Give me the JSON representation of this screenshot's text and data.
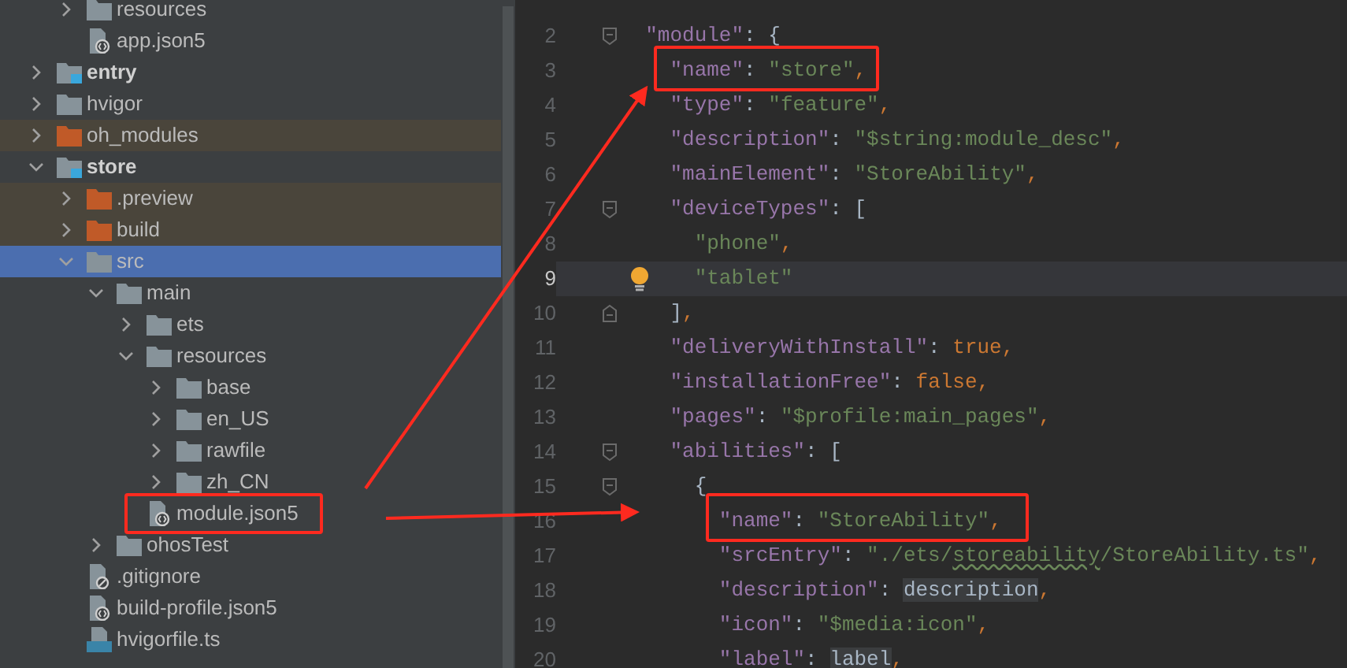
{
  "project_tree": [
    {
      "children": [
        {
          "label": "resources",
          "kind": "folder",
          "expanded": false,
          "excluded": false,
          "selected": false,
          "boxed": false
        },
        {
          "label": "app.json5",
          "kind": "json5",
          "selected": false,
          "boxed": false
        }
      ]
    },
    {
      "label": "entry",
      "kind": "module",
      "expanded": false,
      "excluded": false,
      "selected": false,
      "boxed": false
    },
    {
      "label": "hvigor",
      "kind": "folder",
      "expanded": false,
      "excluded": false,
      "selected": false,
      "boxed": false
    },
    {
      "label": "oh_modules",
      "kind": "folder",
      "expanded": false,
      "excluded": true,
      "selected": false,
      "boxed": false
    },
    {
      "label": "store",
      "kind": "module",
      "expanded": true,
      "excluded": false,
      "selected": false,
      "boxed": false,
      "children": [
        {
          "label": ".preview",
          "kind": "folder",
          "expanded": false,
          "excluded": true,
          "selected": false,
          "boxed": false
        },
        {
          "label": "build",
          "kind": "folder",
          "expanded": false,
          "excluded": true,
          "selected": false,
          "boxed": false
        },
        {
          "label": "src",
          "kind": "folder",
          "expanded": true,
          "excluded": false,
          "selected": true,
          "boxed": false,
          "children": [
            {
              "label": "main",
              "kind": "folder",
              "expanded": true,
              "excluded": false,
              "selected": false,
              "boxed": false,
              "children": [
                {
                  "label": "ets",
                  "kind": "folder",
                  "expanded": false,
                  "excluded": false,
                  "selected": false,
                  "boxed": false
                },
                {
                  "label": "resources",
                  "kind": "folder",
                  "expanded": true,
                  "excluded": false,
                  "selected": false,
                  "boxed": false,
                  "children": [
                    {
                      "label": "base",
                      "kind": "folder",
                      "expanded": false,
                      "excluded": false,
                      "selected": false,
                      "boxed": false
                    },
                    {
                      "label": "en_US",
                      "kind": "folder",
                      "expanded": false,
                      "excluded": false,
                      "selected": false,
                      "boxed": false
                    },
                    {
                      "label": "rawfile",
                      "kind": "folder",
                      "expanded": false,
                      "excluded": false,
                      "selected": false,
                      "boxed": false
                    },
                    {
                      "label": "zh_CN",
                      "kind": "folder",
                      "expanded": false,
                      "excluded": false,
                      "selected": false,
                      "boxed": false
                    }
                  ]
                },
                {
                  "label": "module.json5",
                  "kind": "json5",
                  "selected": false,
                  "boxed": true
                }
              ]
            },
            {
              "label": "ohosTest",
              "kind": "folder",
              "expanded": false,
              "excluded": false,
              "selected": false,
              "boxed": false
            }
          ]
        },
        {
          "label": ".gitignore",
          "kind": "gitignore",
          "selected": false,
          "boxed": false
        },
        {
          "label": "build-profile.json5",
          "kind": "json5",
          "selected": false,
          "boxed": false
        },
        {
          "label": "hvigorfile.ts",
          "kind": "ts",
          "selected": false,
          "boxed": false
        }
      ]
    }
  ],
  "editor": {
    "lines": [
      {
        "number": "2",
        "fold_start": true,
        "fold_end": false,
        "current": false,
        "boxed": false,
        "bulb": false,
        "tokens": [
          {
            "kind": "key",
            "text": "  \"module\""
          },
          {
            "kind": "punct",
            "text": ": {"
          }
        ]
      },
      {
        "number": "3",
        "fold_start": false,
        "fold_end": false,
        "current": false,
        "boxed": true,
        "bulb": false,
        "tokens": [
          {
            "kind": "key",
            "text": "    \"name\""
          },
          {
            "kind": "punct",
            "text": ": "
          },
          {
            "kind": "string",
            "text": "\"store\""
          },
          {
            "kind": "comma",
            "text": ","
          }
        ]
      },
      {
        "number": "4",
        "fold_start": false,
        "fold_end": false,
        "current": false,
        "boxed": false,
        "bulb": false,
        "tokens": [
          {
            "kind": "key",
            "text": "    \"type\""
          },
          {
            "kind": "punct",
            "text": ": "
          },
          {
            "kind": "string",
            "text": "\"feature\""
          },
          {
            "kind": "comma",
            "text": ","
          }
        ]
      },
      {
        "number": "5",
        "fold_start": false,
        "fold_end": false,
        "current": false,
        "boxed": false,
        "bulb": false,
        "tokens": [
          {
            "kind": "key",
            "text": "    \"description\""
          },
          {
            "kind": "punct",
            "text": ": "
          },
          {
            "kind": "string",
            "text": "\"$string:module_desc\""
          },
          {
            "kind": "comma",
            "text": ","
          }
        ]
      },
      {
        "number": "6",
        "fold_start": false,
        "fold_end": false,
        "current": false,
        "boxed": false,
        "bulb": false,
        "tokens": [
          {
            "kind": "key",
            "text": "    \"mainElement\""
          },
          {
            "kind": "punct",
            "text": ": "
          },
          {
            "kind": "string",
            "text": "\"StoreAbility\""
          },
          {
            "kind": "comma",
            "text": ","
          }
        ]
      },
      {
        "number": "7",
        "fold_start": true,
        "fold_end": false,
        "current": false,
        "boxed": false,
        "bulb": false,
        "tokens": [
          {
            "kind": "key",
            "text": "    \"deviceTypes\""
          },
          {
            "kind": "punct",
            "text": ": ["
          }
        ]
      },
      {
        "number": "8",
        "fold_start": false,
        "fold_end": false,
        "current": false,
        "boxed": false,
        "bulb": false,
        "tokens": [
          {
            "kind": "string",
            "text": "      \"phone\""
          },
          {
            "kind": "comma",
            "text": ","
          }
        ]
      },
      {
        "number": "9",
        "fold_start": false,
        "fold_end": false,
        "current": true,
        "boxed": false,
        "bulb": true,
        "tokens": [
          {
            "kind": "string",
            "text": "      \"tablet\""
          }
        ]
      },
      {
        "number": "10",
        "fold_start": false,
        "fold_end": true,
        "current": false,
        "boxed": false,
        "bulb": false,
        "tokens": [
          {
            "kind": "punct",
            "text": "    ]"
          },
          {
            "kind": "comma",
            "text": ","
          }
        ]
      },
      {
        "number": "11",
        "fold_start": false,
        "fold_end": false,
        "current": false,
        "boxed": false,
        "bulb": false,
        "tokens": [
          {
            "kind": "key",
            "text": "    \"deliveryWithInstall\""
          },
          {
            "kind": "punct",
            "text": ": "
          },
          {
            "kind": "bool",
            "text": "true"
          },
          {
            "kind": "comma",
            "text": ","
          }
        ]
      },
      {
        "number": "12",
        "fold_start": false,
        "fold_end": false,
        "current": false,
        "boxed": false,
        "bulb": false,
        "tokens": [
          {
            "kind": "key",
            "text": "    \"installationFree\""
          },
          {
            "kind": "punct",
            "text": ": "
          },
          {
            "kind": "bool",
            "text": "false"
          },
          {
            "kind": "comma",
            "text": ","
          }
        ]
      },
      {
        "number": "13",
        "fold_start": false,
        "fold_end": false,
        "current": false,
        "boxed": false,
        "bulb": false,
        "tokens": [
          {
            "kind": "key",
            "text": "    \"pages\""
          },
          {
            "kind": "punct",
            "text": ": "
          },
          {
            "kind": "string",
            "text": "\"$profile:main_pages\""
          },
          {
            "kind": "comma",
            "text": ","
          }
        ]
      },
      {
        "number": "14",
        "fold_start": true,
        "fold_end": false,
        "current": false,
        "boxed": false,
        "bulb": false,
        "tokens": [
          {
            "kind": "key",
            "text": "    \"abilities\""
          },
          {
            "kind": "punct",
            "text": ": ["
          }
        ]
      },
      {
        "number": "15",
        "fold_start": true,
        "fold_end": false,
        "current": false,
        "boxed": false,
        "bulb": false,
        "tokens": [
          {
            "kind": "punct",
            "text": "      {"
          }
        ]
      },
      {
        "number": "16",
        "fold_start": false,
        "fold_end": false,
        "current": false,
        "boxed": true,
        "bulb": false,
        "tokens": [
          {
            "kind": "key",
            "text": "        \"name\""
          },
          {
            "kind": "punct",
            "text": ": "
          },
          {
            "kind": "string",
            "text": "\"StoreAbility\""
          },
          {
            "kind": "comma",
            "text": ","
          }
        ]
      },
      {
        "number": "17",
        "fold_start": false,
        "fold_end": false,
        "current": false,
        "boxed": false,
        "bulb": false,
        "tokens": [
          {
            "kind": "key",
            "text": "        \"srcEntry\""
          },
          {
            "kind": "punct",
            "text": ": "
          },
          {
            "kind": "string",
            "text": "\"./ets/"
          },
          {
            "kind": "typo",
            "text": "storeability"
          },
          {
            "kind": "string",
            "text": "/StoreAbility.ts\""
          },
          {
            "kind": "comma",
            "text": ","
          }
        ]
      },
      {
        "number": "18",
        "fold_start": false,
        "fold_end": false,
        "current": false,
        "boxed": false,
        "bulb": false,
        "tokens": [
          {
            "kind": "key",
            "text": "        \"description\""
          },
          {
            "kind": "punct",
            "text": ": "
          },
          {
            "kind": "ref",
            "text": "description"
          },
          {
            "kind": "comma",
            "text": ","
          }
        ]
      },
      {
        "number": "19",
        "fold_start": false,
        "fold_end": false,
        "current": false,
        "boxed": false,
        "bulb": false,
        "tokens": [
          {
            "kind": "key",
            "text": "        \"icon\""
          },
          {
            "kind": "punct",
            "text": ": "
          },
          {
            "kind": "string",
            "text": "\"$media:icon\""
          },
          {
            "kind": "comma",
            "text": ","
          }
        ]
      },
      {
        "number": "20",
        "fold_start": false,
        "fold_end": false,
        "current": false,
        "boxed": false,
        "bulb": false,
        "tokens": [
          {
            "kind": "key",
            "text": "        \"label\""
          },
          {
            "kind": "punct",
            "text": ": "
          },
          {
            "kind": "ref",
            "text": "label"
          },
          {
            "kind": "comma",
            "text": ","
          }
        ]
      }
    ]
  }
}
